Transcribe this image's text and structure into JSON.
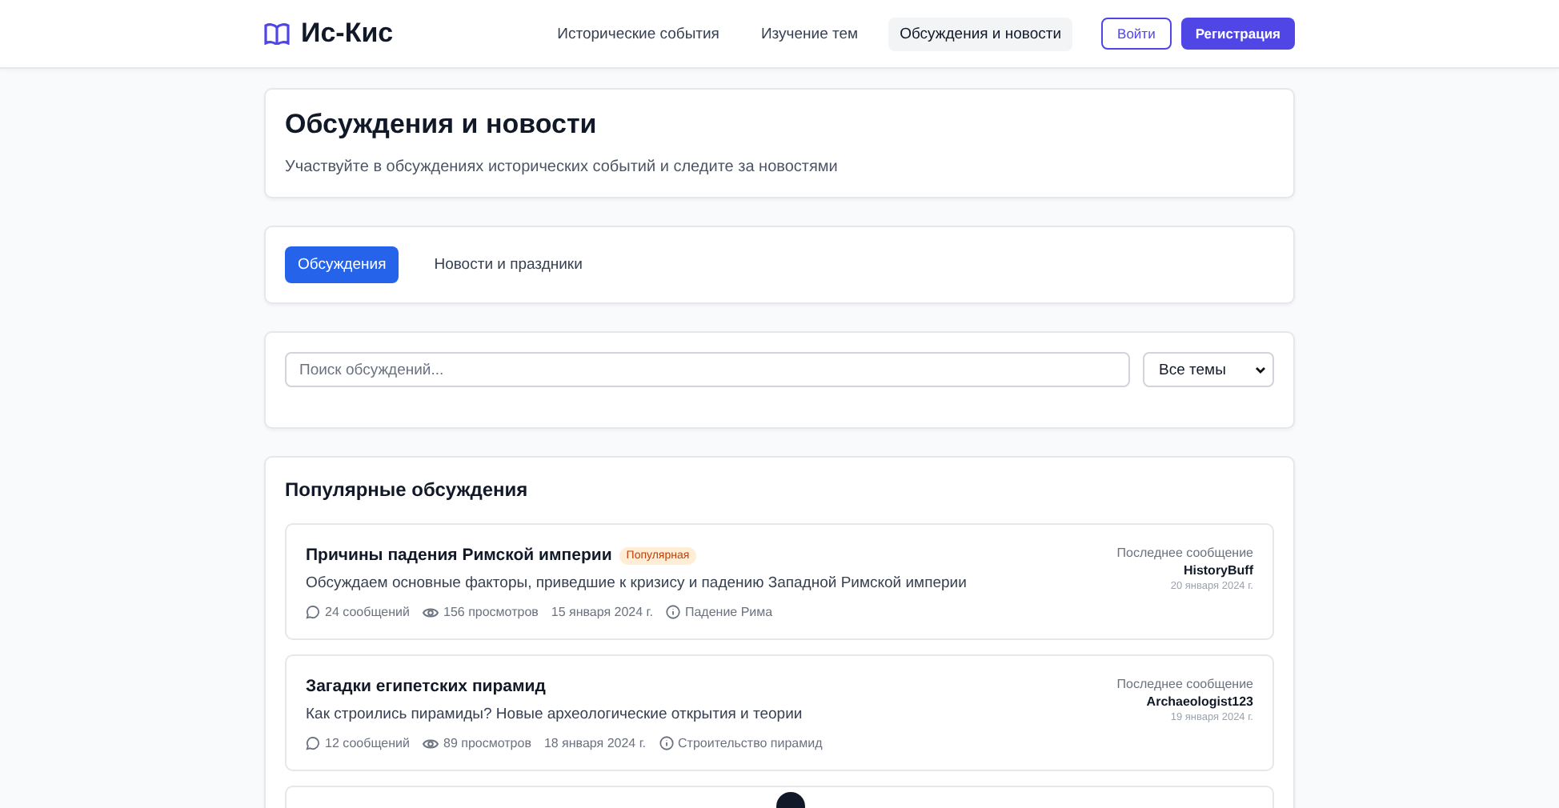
{
  "header": {
    "logo": "Ис-Кис",
    "nav": [
      {
        "label": "Исторические события",
        "selected": false
      },
      {
        "label": "Изучение тем",
        "selected": false
      },
      {
        "label": "Обсуждения и новости",
        "selected": true
      }
    ],
    "login": "Войти",
    "register": "Регистрация"
  },
  "intro": {
    "title": "Обсуждения и новости",
    "subtitle": "Участвуйте в обсуждениях исторических событий и следите за новостями"
  },
  "tabs": [
    {
      "label": "Обсуждения",
      "selected": true
    },
    {
      "label": "Новости и праздники",
      "selected": false
    }
  ],
  "search": {
    "placeholder": "Поиск обсуждений...",
    "filter": "Все темы"
  },
  "popular": {
    "title": "Популярные обсуждения",
    "posts": [
      {
        "title": "Причины падения Римской империи",
        "badge": "Популярная",
        "description": "Обсуждаем основные факторы, приведшие к кризису и падению Западной Римской империи",
        "messages": "24 сообщений",
        "views": "156 просмотров",
        "date": "15 января 2024 г.",
        "topic": "Падение Рима",
        "last_label": "Последнее сообщение",
        "last_author": "HistoryBuff",
        "last_date": "20 января 2024 г."
      },
      {
        "title": "Загадки египетских пирамид",
        "description": "Как строились пирамиды? Новые археологические открытия и теории",
        "messages": "12 сообщений",
        "views": "89 просмотров",
        "date": "18 января 2024 г.",
        "topic": "Строительство пирамид",
        "last_label": "Последнее сообщение",
        "last_author": "Archaeologist123",
        "last_date": "19 января 2024 г."
      }
    ]
  }
}
